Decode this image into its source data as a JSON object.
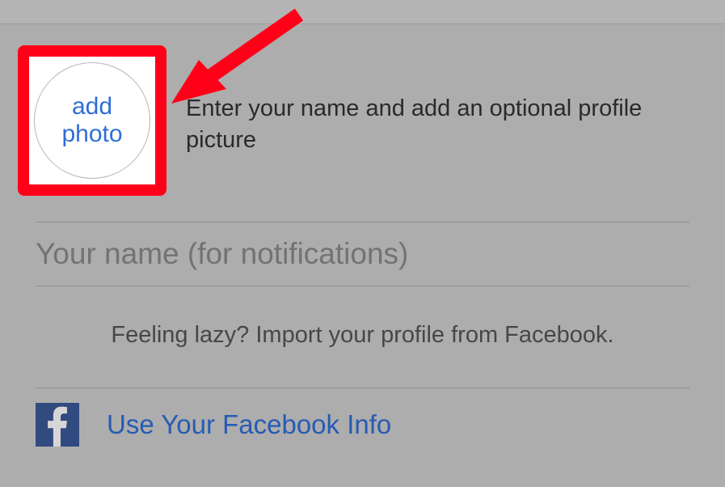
{
  "profile": {
    "add_photo_label": "add photo",
    "instruction": "Enter your name and add an optional profile picture"
  },
  "name_field": {
    "placeholder": "Your name (for notifications)",
    "value": ""
  },
  "import": {
    "lazy_prompt": "Feeling lazy? Import your profile from Facebook.",
    "facebook_button": "Use Your Facebook Info"
  }
}
